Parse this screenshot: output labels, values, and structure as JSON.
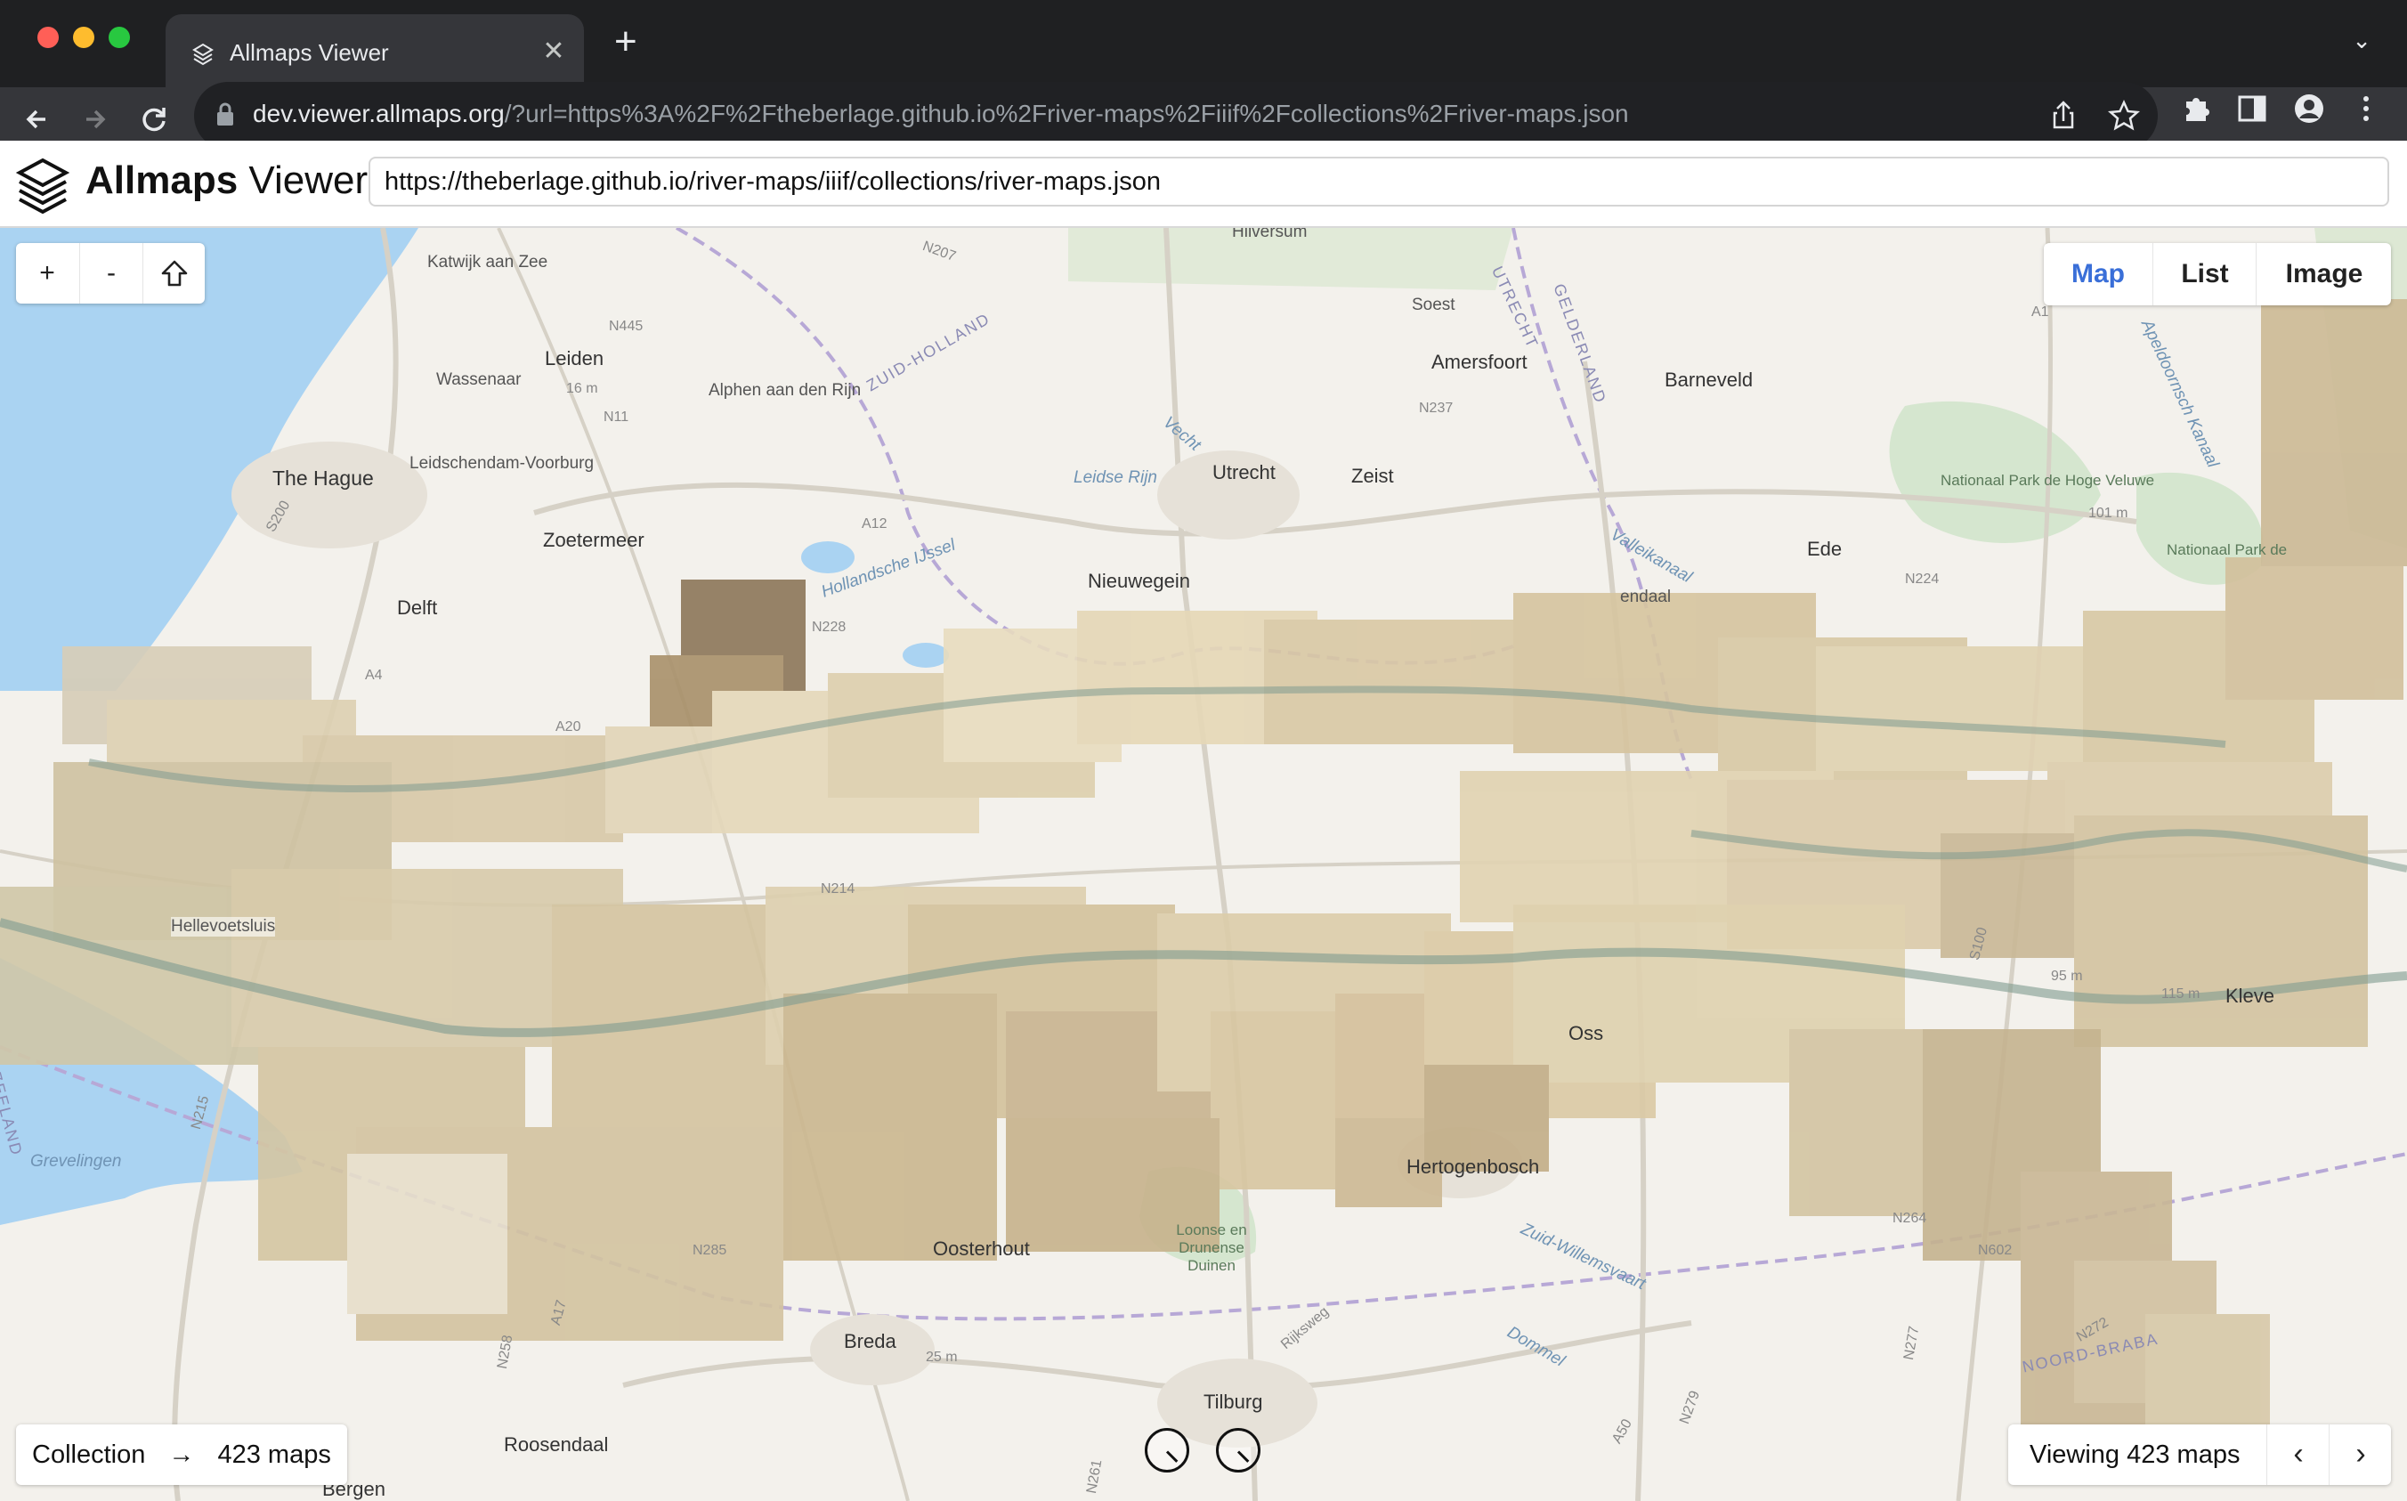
{
  "browser": {
    "tab_title": "Allmaps Viewer",
    "tab_close": "✕",
    "new_tab": "+",
    "tab_menu": "⌄",
    "url_host": "dev.viewer.allmaps.org",
    "url_rest": "/?url=https%3A%2F%2Ftheberlage.github.io%2Friver-maps%2Fiiif%2Fcollections%2Friver-maps.json",
    "icons": [
      "back-icon",
      "forward-icon",
      "reload-icon",
      "lock-icon",
      "share-icon",
      "bookmark-star-icon",
      "extensions-icon",
      "sidebar-icon",
      "profile-icon",
      "menu-icon"
    ]
  },
  "app": {
    "brand_bold": "Allmaps",
    "brand_light": "Viewer",
    "url_value": "https://theberlage.github.io/river-maps/iiif/collections/river-maps.json"
  },
  "controls": {
    "zoom_in": "+",
    "zoom_out": "-",
    "home": "⇧",
    "views": [
      {
        "label": "Map",
        "active": true
      },
      {
        "label": "List",
        "active": false
      },
      {
        "label": "Image",
        "active": false
      }
    ],
    "collection_label": "Collection",
    "collection_arrow": "→",
    "collection_count": "423 maps",
    "viewing_text": "Viewing 423 maps",
    "prev": "‹",
    "next": "›"
  },
  "map_labels": {
    "katwijk": "Katwijk aan Zee",
    "hilversum": "Hilversum",
    "gelderland": "GELDERLAND",
    "utrecht_prov": "UTRECHT",
    "soest": "Soest",
    "leiden": "Leiden",
    "wassenaar": "Wassenaar",
    "alphen": "Alphen aan den Rijn",
    "zuid_holland": "ZUID-HOLLAND",
    "amersfoort": "Amersfoort",
    "barneveld": "Barneveld",
    "the_hague": "The Hague",
    "leidschendam": "Leidschendam-Voorburg",
    "utrecht": "Utrecht",
    "zeist": "Zeist",
    "park_hoge_veluwe": "Nationaal Park de Hoge Veluwe",
    "zoetermeer": "Zoetermeer",
    "nieuwegein": "Nieuwegein",
    "ede": "Ede",
    "park_veluwe2": "Nationaal Park de",
    "delft": "Delft",
    "veenendaal": "endaal",
    "hellevoetsluis": "Hellevoetsluis",
    "oss": "Oss",
    "kleve": "Kleve",
    "zeeland": "ZEELAND",
    "hertogenbosch": "Hertogenbosch",
    "grevelingen": "Grevelingen",
    "oosterhout": "Oosterhout",
    "loonse": "Loonse en Drunense Duinen",
    "breda": "Breda",
    "tilburg": "Tilburg",
    "noord_brabant": "NOORD-BRABA",
    "roosendaal": "Roosendaal",
    "bergen": "Bergen",
    "r_leidse_rijn": "Leidse Rijn",
    "r_hollandse_ijssel": "Hollandsche IJssel",
    "r_vecht": "Vecht",
    "r_dommel": "Dommel",
    "r_zuid_willemsvaart": "Zuid-Willemsvaart",
    "r_valleikanaal": "Valleikanaal",
    "r_apeldoorns": "Apeldoornsch Kanaal",
    "e_16m": "16 m",
    "e_101m": "101 m",
    "e_95m": "95 m",
    "e_115m": "115 m",
    "e_25m": "25 m",
    "rd_a12": "A12",
    "rd_a1": "A1",
    "rd_a4": "A4",
    "rd_a20": "A20",
    "rd_n214": "N214",
    "rd_n11": "N11",
    "rd_n445": "N445",
    "rd_n237": "N237",
    "rd_n224": "N224",
    "rd_n285": "N285",
    "rd_n264": "N264",
    "rd_n602": "N602",
    "rd_a50": "A50",
    "rd_rijksweg": "Rijksweg",
    "rd_a17": "A17",
    "rd_n228": "N228",
    "rd_n215": "N215",
    "rd_s100": "S100",
    "rd_s200": "S200",
    "rd_n207": "N207",
    "rd_n272": "N272",
    "rd_n279": "N279",
    "rd_n277": "N277",
    "rd_n258": "N258",
    "rd_n261": "N261"
  }
}
